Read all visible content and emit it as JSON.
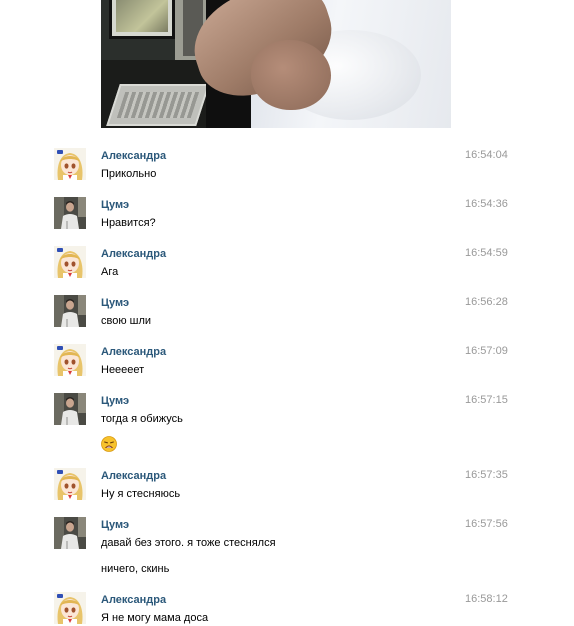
{
  "messages": [
    {
      "author": "Александра",
      "time": "16:54:04",
      "lines": [
        "Прикольно"
      ],
      "avatar": "anime-girl-avatar"
    },
    {
      "author": "Цумэ",
      "time": "16:54:36",
      "lines": [
        "Нравится?"
      ],
      "avatar": "boy-photo-avatar"
    },
    {
      "author": "Александра",
      "time": "16:54:59",
      "lines": [
        "Ага"
      ],
      "avatar": "anime-girl-avatar"
    },
    {
      "author": "Цумэ",
      "time": "16:56:28",
      "lines": [
        "свою шли"
      ],
      "avatar": "boy-photo-avatar"
    },
    {
      "author": "Александра",
      "time": "16:57:09",
      "lines": [
        "Нееееет"
      ],
      "avatar": "anime-girl-avatar"
    },
    {
      "author": "Цумэ",
      "time": "16:57:15",
      "lines": [
        "тогда я обижусь"
      ],
      "emoji": "weary-face-emoji",
      "avatar": "boy-photo-avatar"
    },
    {
      "author": "Александра",
      "time": "16:57:35",
      "lines": [
        "Ну я стесняюсь"
      ],
      "avatar": "anime-girl-avatar"
    },
    {
      "author": "Цумэ",
      "time": "16:57:56",
      "lines": [
        "давай без этого. я тоже стеснялся",
        "ничего, скинь"
      ],
      "avatar": "boy-photo-avatar"
    },
    {
      "author": "Александра",
      "time": "16:58:12",
      "lines": [
        "Я не могу мама доса"
      ],
      "avatar": "anime-girl-avatar"
    }
  ],
  "colors": {
    "author": "#2b587a",
    "time": "#999999",
    "text": "#000000"
  }
}
